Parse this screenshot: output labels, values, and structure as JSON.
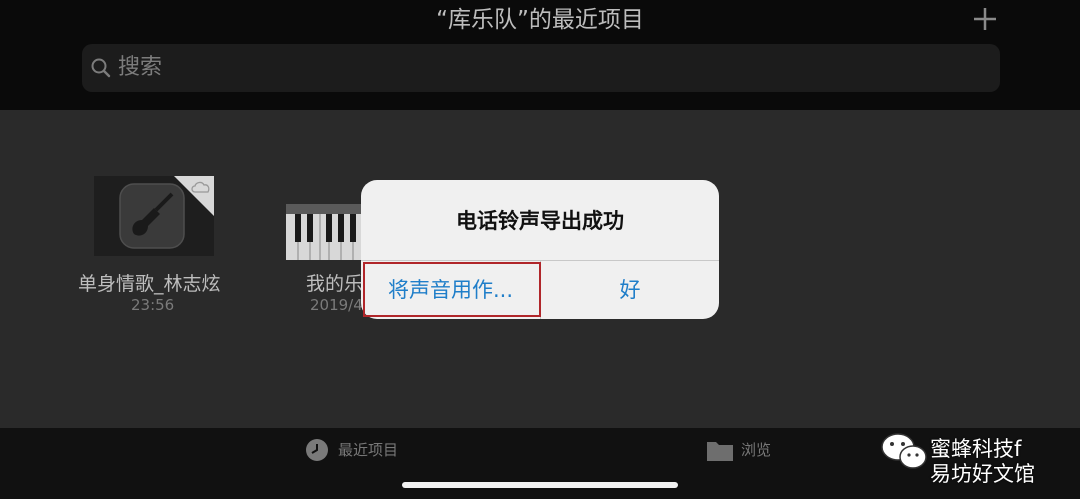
{
  "header": {
    "title": "“库乐队”的最近项目",
    "add_icon": "plus-icon"
  },
  "search": {
    "placeholder": "搜索",
    "icon": "search-icon"
  },
  "files": [
    {
      "name": "单身情歌_林志炫",
      "date": "23:56",
      "icon": "garageband-guitar-icon",
      "badge": "cloud-icon"
    },
    {
      "name": "我的乐",
      "date": "2019/4",
      "icon": "keyboard-icon"
    }
  ],
  "dialog": {
    "title": "电话铃声导出成功",
    "use_sound_as": "将声音用作...",
    "ok": "好"
  },
  "tabbar": {
    "recent": "最近项目",
    "browse": "浏览"
  },
  "watermark": {
    "line1": "蜜蜂科技f",
    "line2": "易坊好文馆"
  },
  "colors": {
    "accent": "#1f7ec9",
    "highlight_border": "#b0262a",
    "dialog_bg": "#f0f0f0"
  }
}
